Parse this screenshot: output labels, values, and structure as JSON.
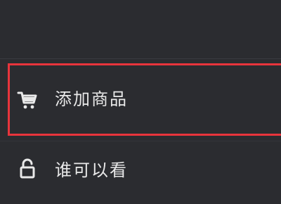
{
  "menu": {
    "items": [
      {
        "label": "添加商品",
        "icon": "shopping-cart-icon",
        "highlighted": true
      },
      {
        "label": "谁可以看",
        "icon": "unlock-icon",
        "highlighted": false
      }
    ]
  },
  "colors": {
    "background": "#2b2c30",
    "text": "#e9e9e9",
    "highlight": "#e8343c"
  }
}
